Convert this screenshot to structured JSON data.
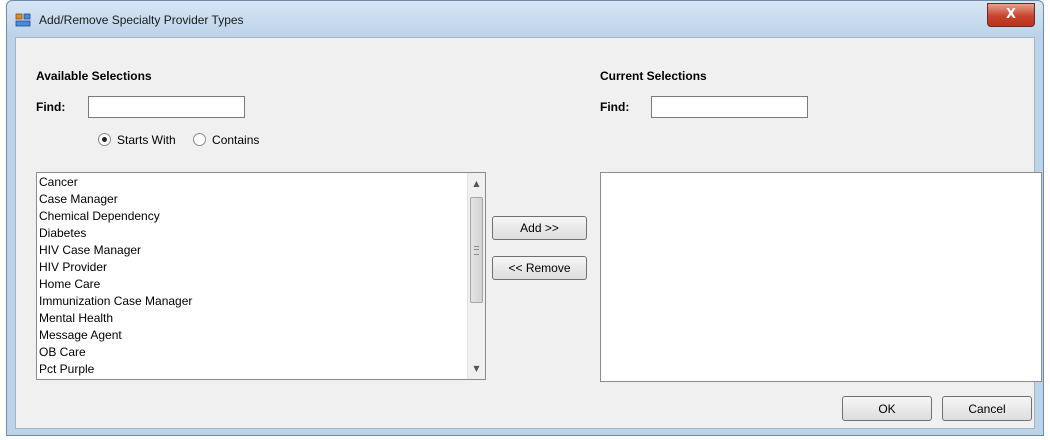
{
  "window": {
    "title": "Add/Remove Specialty Provider Types",
    "close_label": "X"
  },
  "available": {
    "heading": "Available Selections",
    "find_label": "Find:",
    "find_value": "",
    "match_options": [
      {
        "label": "Starts With",
        "selected": true
      },
      {
        "label": "Contains",
        "selected": false
      }
    ],
    "items": [
      "Cancer",
      "Case Manager",
      "Chemical Dependency",
      "Diabetes",
      "HIV Case Manager",
      "HIV Provider",
      "Home Care",
      "Immunization Case Manager",
      "Mental Health",
      "Message Agent",
      "OB Care",
      "Pct Purple"
    ]
  },
  "current": {
    "heading": "Current Selections",
    "find_label": "Find:",
    "find_value": "",
    "items": []
  },
  "buttons": {
    "add": "Add >>",
    "remove": "<< Remove",
    "ok": "OK",
    "cancel": "Cancel"
  },
  "icons": {
    "app": "window-app-icon",
    "scroll_up": "scroll-up-arrow-icon",
    "scroll_down": "scroll-down-arrow-icon"
  }
}
